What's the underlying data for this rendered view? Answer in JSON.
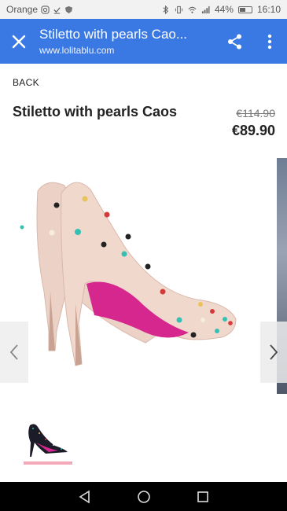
{
  "status_bar": {
    "carrier": "Orange",
    "battery": "44%",
    "time": "16:10"
  },
  "app_bar": {
    "title": "Stiletto with pearls Cao...",
    "url": "www.lolitablu.com"
  },
  "page": {
    "back_label": "BACK",
    "product_name": "Stiletto with pearls Caos",
    "price_old": "€114.90",
    "price_new": "€89.90"
  },
  "colors": {
    "app_bar": "#3a79e3",
    "thumb_selected": "#f3a9b7",
    "shoe_nude": "#ecd2c6",
    "sole_pink": "#d6278e"
  },
  "icons": [
    "close-icon",
    "share-icon",
    "more-vert-icon",
    "chevron-left-icon",
    "chevron-right-icon",
    "back-triangle-icon",
    "home-circle-icon",
    "recents-square-icon"
  ]
}
